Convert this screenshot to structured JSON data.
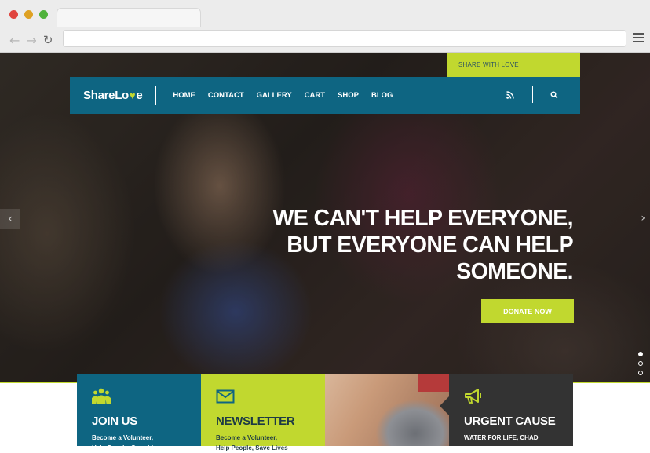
{
  "browser": {
    "url": "",
    "icons": {
      "back": "back-arrow-icon",
      "forward": "forward-arrow-icon",
      "reload": "reload-icon",
      "menu": "hamburger-menu-icon"
    }
  },
  "site": {
    "share_tab": "SHARE WITH LOVE",
    "logo": {
      "prefix": "ShareLo",
      "heart": "♥",
      "suffix": "e"
    },
    "nav": [
      "HOME",
      "CONTACT",
      "GALLERY",
      "CART",
      "SHOP",
      "BLOG"
    ],
    "icons": {
      "rss": "rss-icon",
      "search": "search-icon"
    },
    "colors": {
      "primary": "#0e6582",
      "accent": "#c1d82f",
      "dark": "#333333"
    }
  },
  "hero": {
    "headline": [
      "WE CAN'T HELP EVERYONE,",
      "BUT EVERYONE CAN HELP",
      "SOMEONE."
    ],
    "cta": "DONATE NOW",
    "slides": 3,
    "active_slide": 1
  },
  "features": {
    "join": {
      "title": "JOIN US",
      "line1": "Become a Volunteer,",
      "line2": "Help People, Save Lives",
      "icon": "people-group-icon"
    },
    "newsletter": {
      "title": "NEWSLETTER",
      "line1": "Become a Volunteer,",
      "line2": "Help People, Save Lives",
      "icon": "envelope-icon"
    },
    "urgent": {
      "title": "URGENT CAUSE",
      "line1": "WATER FOR LIFE, CHAD",
      "icon": "megaphone-icon"
    }
  }
}
